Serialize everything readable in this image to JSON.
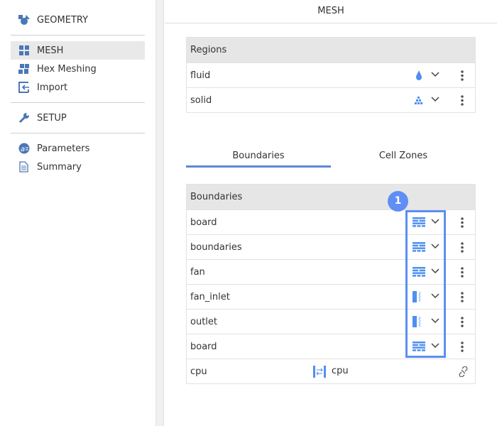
{
  "sidebar": {
    "items": [
      {
        "label": "GEOMETRY",
        "icon": "geometry-icon"
      },
      {
        "label": "MESH",
        "icon": "mesh-icon",
        "selected": true
      },
      {
        "label": "Hex Meshing",
        "icon": "hex-meshing-icon"
      },
      {
        "label": "Import",
        "icon": "import-icon"
      },
      {
        "label": "SETUP",
        "icon": "wrench-icon"
      },
      {
        "label": "Parameters",
        "icon": "parameters-icon"
      },
      {
        "label": "Summary",
        "icon": "document-icon"
      }
    ]
  },
  "main": {
    "title": "MESH",
    "regions": {
      "header": "Regions",
      "rows": [
        {
          "name": "fluid",
          "icon": "droplet-icon"
        },
        {
          "name": "solid",
          "icon": "blocks-icon"
        }
      ]
    },
    "tabs": [
      {
        "label": "Boundaries",
        "active": true
      },
      {
        "label": "Cell Zones"
      }
    ],
    "boundaries": {
      "header": "Boundaries",
      "rows": [
        {
          "name": "board",
          "icon": "wall-icon"
        },
        {
          "name": "boundaries",
          "icon": "wall-icon"
        },
        {
          "name": "fan",
          "icon": "wall-icon"
        },
        {
          "name": "fan_inlet",
          "icon": "inlet-icon"
        },
        {
          "name": "outlet",
          "icon": "inlet-icon"
        },
        {
          "name": "board",
          "icon": "wall-icon"
        }
      ],
      "interface": {
        "name": "cpu",
        "pair": "cpu",
        "icon": "interface-icon",
        "link_icon": "unlink-icon"
      }
    },
    "badge": "1",
    "accent": "#5b8ff2"
  }
}
